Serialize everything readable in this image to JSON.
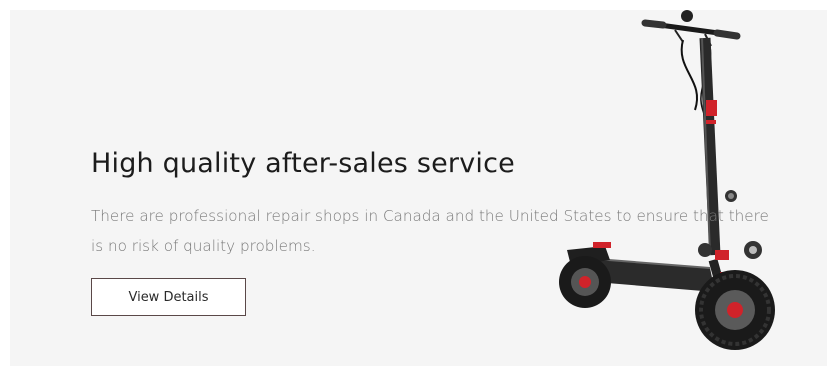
{
  "banner": {
    "title": "High quality after-sales service",
    "description": "There are professional repair shops in Canada and the United States to ensure that there is no risk of quality problems.",
    "button_label": "View Details",
    "product_image": "electric-scooter"
  },
  "colors": {
    "background": "#f5f5f5",
    "title": "#1c1c1c",
    "description": "#7a7a7a",
    "button_border": "#5a4848",
    "accent_red": "#d0232a"
  }
}
